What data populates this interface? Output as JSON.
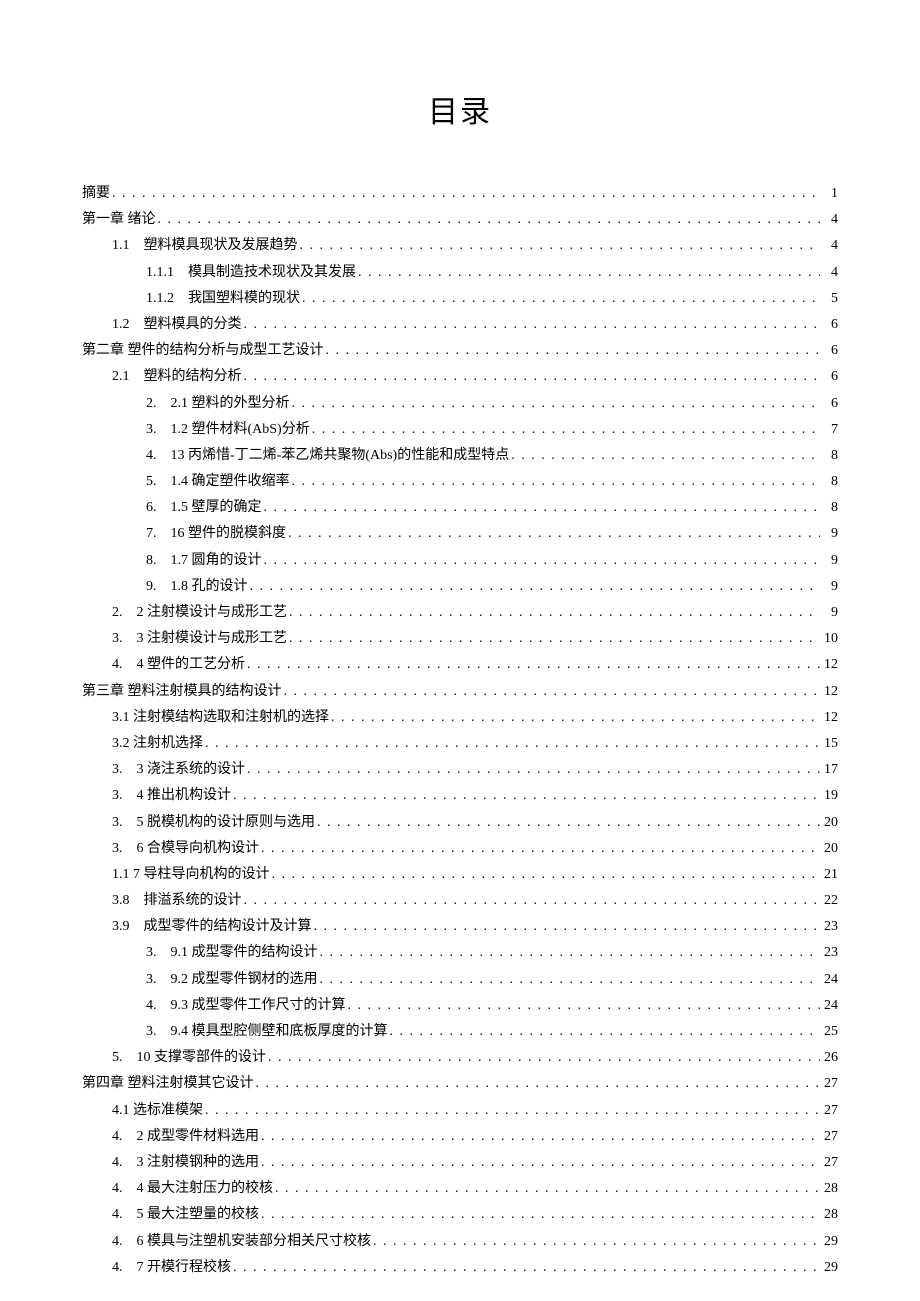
{
  "title": "目录",
  "entries": [
    {
      "indent": 0,
      "label": "摘要",
      "page": "1"
    },
    {
      "indent": 0,
      "label": "第一章 绪论",
      "page": "4"
    },
    {
      "indent": 1,
      "label": "1.1　塑料模具现状及发展趋势",
      "page": "4"
    },
    {
      "indent": 2,
      "label": "1.1.1　模具制造技术现状及其发展",
      "page": "4"
    },
    {
      "indent": 2,
      "label": "1.1.2　我国塑料模的现状",
      "page": "5"
    },
    {
      "indent": 1,
      "label": "1.2　塑料模具的分类",
      "page": "6"
    },
    {
      "indent": 0,
      "label": "第二章 塑件的结构分析与成型工艺设计",
      "page": "6"
    },
    {
      "indent": 1,
      "label": "2.1　塑料的结构分析",
      "page": "6"
    },
    {
      "indent": 2,
      "label": "2.　2.1 塑料的外型分析",
      "page": "6"
    },
    {
      "indent": 2,
      "label": "3.　1.2 塑件材料(AbS)分析",
      "page": "7"
    },
    {
      "indent": 2,
      "label": "4.　13 丙烯惜-丁二烯-苯乙烯共聚物(Abs)的性能和成型特点",
      "page": "8"
    },
    {
      "indent": 2,
      "label": "5.　1.4 确定塑件收缩率",
      "page": "8"
    },
    {
      "indent": 2,
      "label": "6.　1.5 壁厚的确定",
      "page": "8"
    },
    {
      "indent": 2,
      "label": "7.　16 塑件的脱模斜度",
      "page": "9"
    },
    {
      "indent": 2,
      "label": "8.　1.7 圆角的设计",
      "page": "9"
    },
    {
      "indent": 2,
      "label": "9.　1.8 孔的设计",
      "page": "9"
    },
    {
      "indent": 1,
      "label": "2.　2 注射模设计与成形工艺",
      "page": "9"
    },
    {
      "indent": 1,
      "label": "3.　3 注射模设计与成形工艺",
      "page": "10"
    },
    {
      "indent": 1,
      "label": "4.　4 塑件的工艺分析",
      "page": "12"
    },
    {
      "indent": 0,
      "label": "第三章 塑料注射模具的结构设计",
      "page": "12"
    },
    {
      "indent": 1,
      "label": "3.1 注射模结构选取和注射机的选择",
      "page": "12"
    },
    {
      "indent": 1,
      "label": "3.2 注射机选择",
      "page": "15"
    },
    {
      "indent": 1,
      "label": "3.　3 浇注系统的设计",
      "page": "17"
    },
    {
      "indent": 1,
      "label": "3.　4 推出机构设计",
      "page": "19"
    },
    {
      "indent": 1,
      "label": "3.　5 脱模机构的设计原则与选用",
      "page": "20"
    },
    {
      "indent": 1,
      "label": "3.　6 合模导向机构设计",
      "page": "20"
    },
    {
      "indent": 1,
      "label": "1.1 7 导柱导向机构的设计",
      "page": "21"
    },
    {
      "indent": 1,
      "label": "3.8　排溢系统的设计",
      "page": "22"
    },
    {
      "indent": 1,
      "label": "3.9　成型零件的结构设计及计算",
      "page": "23"
    },
    {
      "indent": 2,
      "label": "3.　9.1 成型零件的结构设计",
      "page": "23"
    },
    {
      "indent": 2,
      "label": "3.　9.2 成型零件钢材的选用",
      "page": "24"
    },
    {
      "indent": 2,
      "label": "4.　9.3 成型零件工作尺寸的计算",
      "page": "24"
    },
    {
      "indent": 2,
      "label": "3.　9.4 模具型腔侧壁和底板厚度的计算",
      "page": "25"
    },
    {
      "indent": 1,
      "label": "5.　10 支撑零部件的设计",
      "page": "26"
    },
    {
      "indent": 0,
      "label": "第四章 塑料注射模其它设计",
      "page": "27"
    },
    {
      "indent": 1,
      "label": "4.1 选标准模架",
      "page": "27"
    },
    {
      "indent": 1,
      "label": "4.　2 成型零件材料选用",
      "page": "27"
    },
    {
      "indent": 1,
      "label": "4.　3 注射模钢种的选用",
      "page": "27"
    },
    {
      "indent": 1,
      "label": "4.　4 最大注射压力的校核",
      "page": "28"
    },
    {
      "indent": 1,
      "label": "4.　5 最大注塑量的校核",
      "page": "28"
    },
    {
      "indent": 1,
      "label": "4.　6 模具与注塑机安装部分相关尺寸校核",
      "page": "29"
    },
    {
      "indent": 1,
      "label": "4.　7 开模行程校核",
      "page": "29"
    }
  ]
}
